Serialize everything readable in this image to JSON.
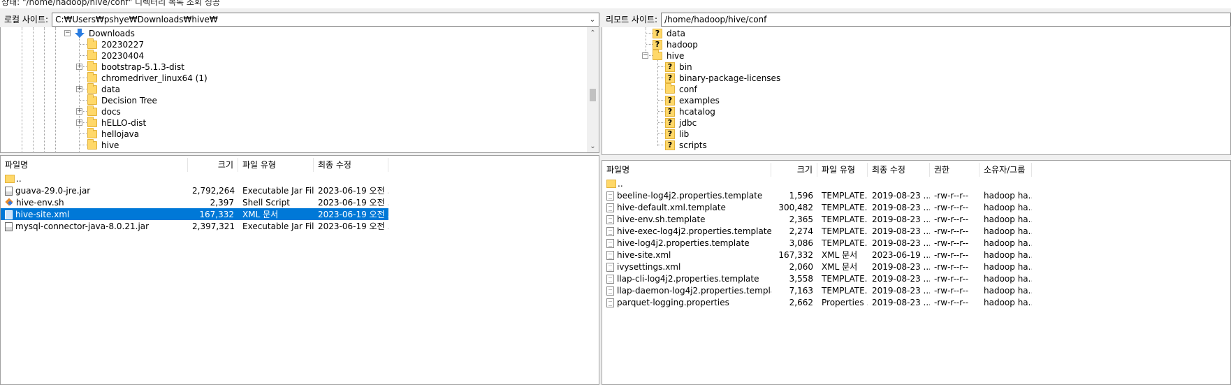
{
  "status_line": "상태: \"/home/hadoop/hive/conf\" 디렉터리 목록 조회 성공",
  "local": {
    "site_label": "로컬 사이트:",
    "path": "C:₩Users₩pshye₩Downloads₩hive₩",
    "tree": [
      {
        "label": "Downloads",
        "expander": "minus",
        "icon": "download"
      },
      {
        "label": "20230227",
        "expander": "",
        "icon": "folder"
      },
      {
        "label": "20230404",
        "expander": "",
        "icon": "folder"
      },
      {
        "label": "bootstrap-5.1.3-dist",
        "expander": "plus",
        "icon": "folder"
      },
      {
        "label": "chromedriver_linux64 (1)",
        "expander": "",
        "icon": "folder"
      },
      {
        "label": "data",
        "expander": "plus",
        "icon": "folder"
      },
      {
        "label": "Decision Tree",
        "expander": "",
        "icon": "folder"
      },
      {
        "label": "docs",
        "expander": "plus",
        "icon": "folder"
      },
      {
        "label": "hELLO-dist",
        "expander": "plus",
        "icon": "folder"
      },
      {
        "label": "hellojava",
        "expander": "",
        "icon": "folder"
      },
      {
        "label": "hive",
        "expander": "",
        "icon": "folder"
      }
    ],
    "columns": {
      "name": "파일명",
      "size": "크기",
      "type": "파일 유형",
      "modified": "최종 수정"
    },
    "updir": "..",
    "files": [
      {
        "name": "guava-29.0-jre.jar",
        "size": "2,792,264",
        "type": "Executable Jar File",
        "modified": "2023-06-19 오전 ...",
        "icon": "jar"
      },
      {
        "name": "hive-env.sh",
        "size": "2,397",
        "type": "Shell Script",
        "modified": "2023-06-19 오전 ...",
        "icon": "sh"
      },
      {
        "name": "hive-site.xml",
        "size": "167,332",
        "type": "XML 문서",
        "modified": "2023-06-19 오전 ...",
        "icon": "xml",
        "selected": true
      },
      {
        "name": "mysql-connector-java-8.0.21.jar",
        "size": "2,397,321",
        "type": "Executable Jar File",
        "modified": "2023-06-19 오전 ...",
        "icon": "jar"
      }
    ]
  },
  "remote": {
    "site_label": "리모트 사이트:",
    "path": "/home/hadoop/hive/conf",
    "tree": [
      {
        "label": "data",
        "icon": "unknown",
        "level": 1
      },
      {
        "label": "hadoop",
        "icon": "unknown",
        "level": 1
      },
      {
        "label": "hive",
        "icon": "folder",
        "level": 1,
        "expander": "minus"
      },
      {
        "label": "bin",
        "icon": "unknown",
        "level": 2
      },
      {
        "label": "binary-package-licenses",
        "icon": "unknown",
        "level": 2
      },
      {
        "label": "conf",
        "icon": "folder",
        "level": 2
      },
      {
        "label": "examples",
        "icon": "unknown",
        "level": 2
      },
      {
        "label": "hcatalog",
        "icon": "unknown",
        "level": 2
      },
      {
        "label": "jdbc",
        "icon": "unknown",
        "level": 2
      },
      {
        "label": "lib",
        "icon": "unknown",
        "level": 2
      },
      {
        "label": "scripts",
        "icon": "unknown",
        "level": 2
      }
    ],
    "columns": {
      "name": "파일명",
      "size": "크기",
      "type": "파일 유형",
      "modified": "최종 수정",
      "perm": "권한",
      "owner": "소유자/그룹"
    },
    "updir": "..",
    "files": [
      {
        "name": "beeline-log4j2.properties.template",
        "size": "1,596",
        "type": "TEMPLATE...",
        "modified": "2019-08-23 ...",
        "perm": "-rw-r--r--",
        "owner": "hadoop ha..."
      },
      {
        "name": "hive-default.xml.template",
        "size": "300,482",
        "type": "TEMPLATE...",
        "modified": "2019-08-23 ...",
        "perm": "-rw-r--r--",
        "owner": "hadoop ha..."
      },
      {
        "name": "hive-env.sh.template",
        "size": "2,365",
        "type": "TEMPLATE...",
        "modified": "2019-08-23 ...",
        "perm": "-rw-r--r--",
        "owner": "hadoop ha..."
      },
      {
        "name": "hive-exec-log4j2.properties.template",
        "size": "2,274",
        "type": "TEMPLATE...",
        "modified": "2019-08-23 ...",
        "perm": "-rw-r--r--",
        "owner": "hadoop ha..."
      },
      {
        "name": "hive-log4j2.properties.template",
        "size": "3,086",
        "type": "TEMPLATE...",
        "modified": "2019-08-23 ...",
        "perm": "-rw-r--r--",
        "owner": "hadoop ha..."
      },
      {
        "name": "hive-site.xml",
        "size": "167,332",
        "type": "XML 문서",
        "modified": "2023-06-19 ...",
        "perm": "-rw-r--r--",
        "owner": "hadoop ha..."
      },
      {
        "name": "ivysettings.xml",
        "size": "2,060",
        "type": "XML 문서",
        "modified": "2019-08-23 ...",
        "perm": "-rw-r--r--",
        "owner": "hadoop ha..."
      },
      {
        "name": "llap-cli-log4j2.properties.template",
        "size": "3,558",
        "type": "TEMPLATE...",
        "modified": "2019-08-23 ...",
        "perm": "-rw-r--r--",
        "owner": "hadoop ha..."
      },
      {
        "name": "llap-daemon-log4j2.properties.template",
        "size": "7,163",
        "type": "TEMPLATE...",
        "modified": "2019-08-23 ...",
        "perm": "-rw-r--r--",
        "owner": "hadoop ha..."
      },
      {
        "name": "parquet-logging.properties",
        "size": "2,662",
        "type": "Properties ...",
        "modified": "2019-08-23 ...",
        "perm": "-rw-r--r--",
        "owner": "hadoop ha..."
      }
    ]
  }
}
